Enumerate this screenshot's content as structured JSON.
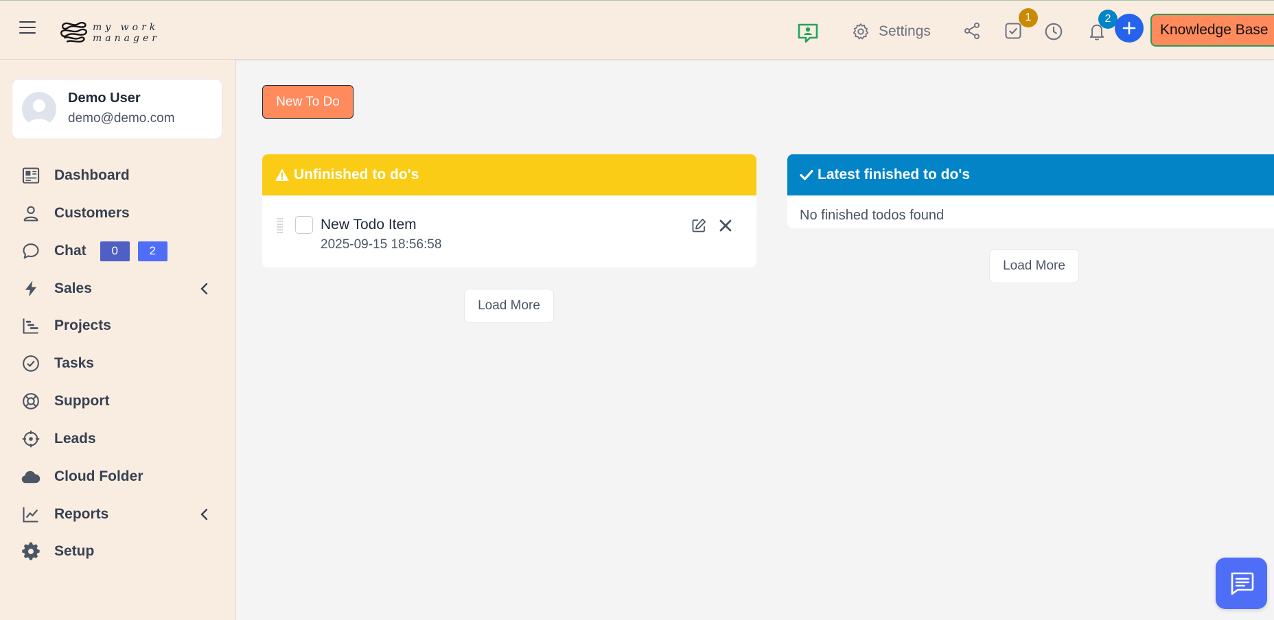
{
  "header": {
    "logo_text": "my work manager",
    "settings_label": "Settings",
    "todo_badge": "1",
    "notifications_badge": "2",
    "knowledge_base_label": "Knowledge Base"
  },
  "profile": {
    "name": "Demo User",
    "email": "demo@demo.com"
  },
  "sidebar": {
    "items": [
      {
        "label": "Dashboard",
        "icon": "dashboard-icon"
      },
      {
        "label": "Customers",
        "icon": "user-icon"
      },
      {
        "label": "Chat",
        "icon": "chat-bubble-icon",
        "badges": [
          "0",
          "2"
        ]
      },
      {
        "label": "Sales",
        "icon": "bolt-icon",
        "has_submenu": true
      },
      {
        "label": "Projects",
        "icon": "gantt-icon"
      },
      {
        "label": "Tasks",
        "icon": "check-circle-icon"
      },
      {
        "label": "Support",
        "icon": "lifebuoy-icon"
      },
      {
        "label": "Leads",
        "icon": "crosshair-icon"
      },
      {
        "label": "Cloud Folder",
        "icon": "cloud-icon"
      },
      {
        "label": "Reports",
        "icon": "line-chart-icon",
        "has_submenu": true
      },
      {
        "label": "Setup",
        "icon": "gear-icon"
      }
    ]
  },
  "main": {
    "new_todo_label": "New To Do",
    "unfinished": {
      "title": "Unfinished to do's",
      "items": [
        {
          "title": "New Todo Item",
          "date": "2025-09-15 18:56:58"
        }
      ],
      "load_more_label": "Load More"
    },
    "finished": {
      "title": "Latest finished to do's",
      "empty_message": "No finished todos found",
      "load_more_label": "Load More"
    }
  },
  "colors": {
    "header_bg": "#f9ede2",
    "accent_orange": "#ff8a5b",
    "warning_yellow": "#facc15",
    "info_blue": "#0284c7",
    "primary_blue": "#2563eb"
  }
}
